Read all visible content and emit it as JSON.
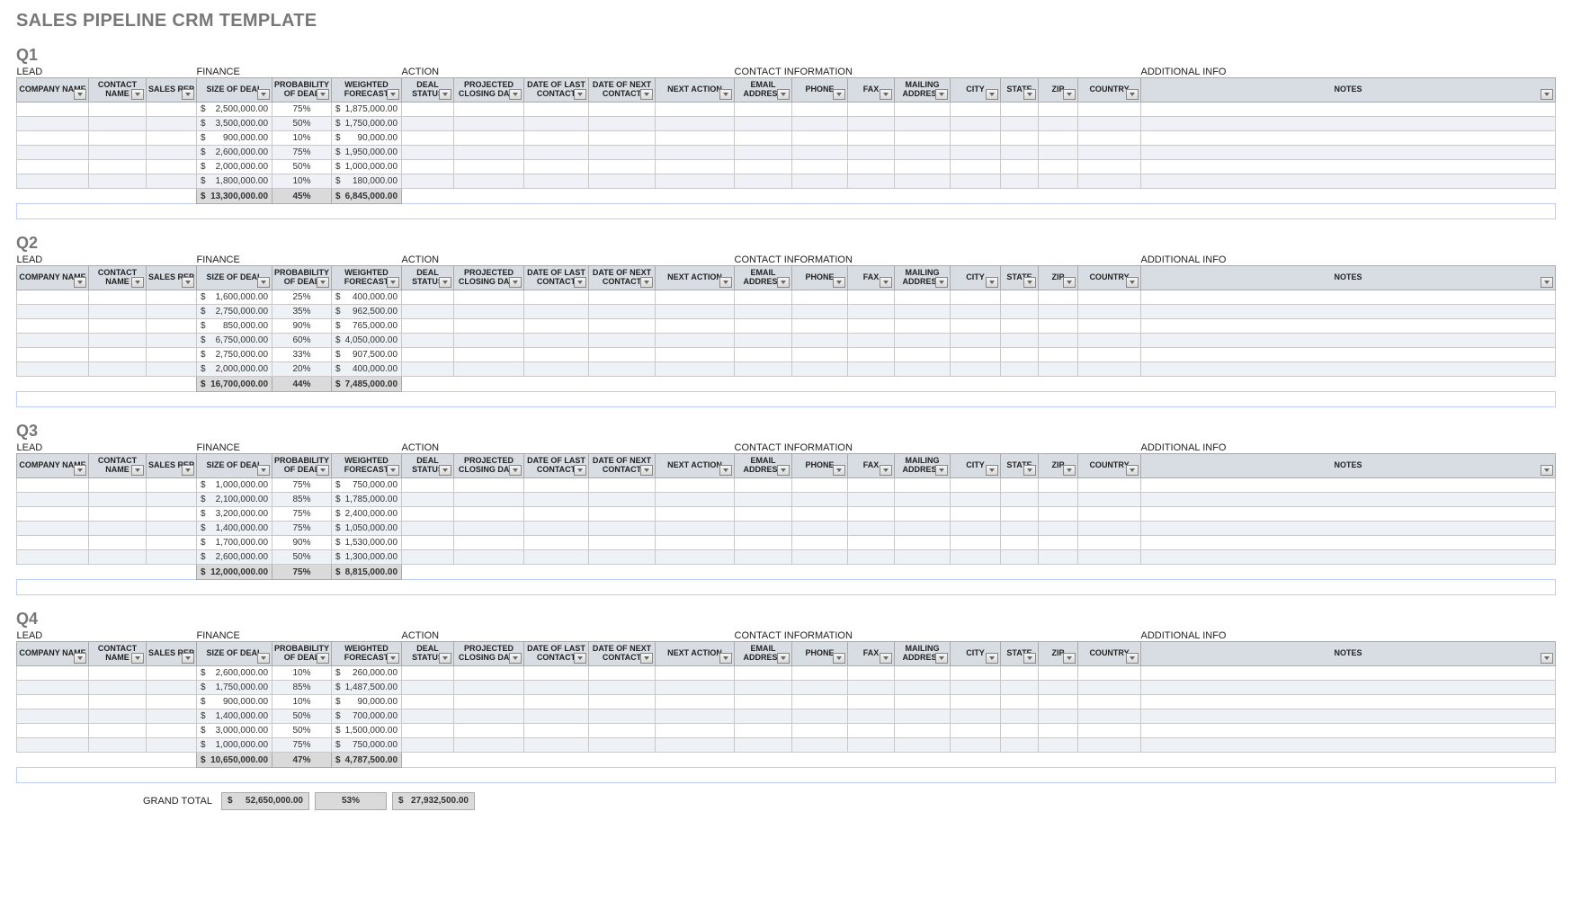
{
  "title": "SALES PIPELINE CRM TEMPLATE",
  "groups": {
    "lead": "LEAD",
    "finance": "FINANCE",
    "action": "ACTION",
    "contactinfo": "CONTACT INFORMATION",
    "additional": "ADDITIONAL INFO"
  },
  "columns": {
    "company": "COMPANY NAME",
    "contact": "CONTACT NAME",
    "rep": "SALES REP",
    "size": "SIZE OF DEAL",
    "prob": "PROBABILITY OF DEAL",
    "wf": "WEIGHTED FORECAST",
    "ds": "DEAL STATUS",
    "pcd": "PROJECTED CLOSING DATE",
    "dlc": "DATE OF LAST CONTACT",
    "dnc": "DATE OF NEXT CONTACT",
    "na": "NEXT ACTION",
    "email": "EMAIL ADDRESS",
    "phone": "PHONE",
    "fax": "FAX",
    "mail": "MAILING ADDRESS",
    "city": "CITY",
    "state": "STATE",
    "zip": "ZIP",
    "country": "COUNTRY",
    "notes": "NOTES"
  },
  "currency": "$",
  "quarters": [
    {
      "name": "Q1",
      "rows": [
        {
          "size": "2,500,000.00",
          "prob": "75%",
          "wf": "1,875,000.00"
        },
        {
          "size": "3,500,000.00",
          "prob": "50%",
          "wf": "1,750,000.00"
        },
        {
          "size": "900,000.00",
          "prob": "10%",
          "wf": "90,000.00"
        },
        {
          "size": "2,600,000.00",
          "prob": "75%",
          "wf": "1,950,000.00"
        },
        {
          "size": "2,000,000.00",
          "prob": "50%",
          "wf": "1,000,000.00"
        },
        {
          "size": "1,800,000.00",
          "prob": "10%",
          "wf": "180,000.00"
        }
      ],
      "totals": {
        "size": "13,300,000.00",
        "prob": "45%",
        "wf": "6,845,000.00"
      }
    },
    {
      "name": "Q2",
      "rows": [
        {
          "size": "1,600,000.00",
          "prob": "25%",
          "wf": "400,000.00"
        },
        {
          "size": "2,750,000.00",
          "prob": "35%",
          "wf": "962,500.00"
        },
        {
          "size": "850,000.00",
          "prob": "90%",
          "wf": "765,000.00"
        },
        {
          "size": "6,750,000.00",
          "prob": "60%",
          "wf": "4,050,000.00"
        },
        {
          "size": "2,750,000.00",
          "prob": "33%",
          "wf": "907,500.00"
        },
        {
          "size": "2,000,000.00",
          "prob": "20%",
          "wf": "400,000.00"
        }
      ],
      "totals": {
        "size": "16,700,000.00",
        "prob": "44%",
        "wf": "7,485,000.00"
      }
    },
    {
      "name": "Q3",
      "rows": [
        {
          "size": "1,000,000.00",
          "prob": "75%",
          "wf": "750,000.00"
        },
        {
          "size": "2,100,000.00",
          "prob": "85%",
          "wf": "1,785,000.00"
        },
        {
          "size": "3,200,000.00",
          "prob": "75%",
          "wf": "2,400,000.00"
        },
        {
          "size": "1,400,000.00",
          "prob": "75%",
          "wf": "1,050,000.00"
        },
        {
          "size": "1,700,000.00",
          "prob": "90%",
          "wf": "1,530,000.00"
        },
        {
          "size": "2,600,000.00",
          "prob": "50%",
          "wf": "1,300,000.00"
        }
      ],
      "totals": {
        "size": "12,000,000.00",
        "prob": "75%",
        "wf": "8,815,000.00"
      }
    },
    {
      "name": "Q4",
      "rows": [
        {
          "size": "2,600,000.00",
          "prob": "10%",
          "wf": "260,000.00"
        },
        {
          "size": "1,750,000.00",
          "prob": "85%",
          "wf": "1,487,500.00"
        },
        {
          "size": "900,000.00",
          "prob": "10%",
          "wf": "90,000.00"
        },
        {
          "size": "1,400,000.00",
          "prob": "50%",
          "wf": "700,000.00"
        },
        {
          "size": "3,000,000.00",
          "prob": "50%",
          "wf": "1,500,000.00"
        },
        {
          "size": "1,000,000.00",
          "prob": "75%",
          "wf": "750,000.00"
        }
      ],
      "totals": {
        "size": "10,650,000.00",
        "prob": "47%",
        "wf": "4,787,500.00"
      }
    }
  ],
  "grand": {
    "label": "GRAND TOTAL",
    "size": "52,650,000.00",
    "prob": "53%",
    "wf": "27,932,500.00"
  }
}
